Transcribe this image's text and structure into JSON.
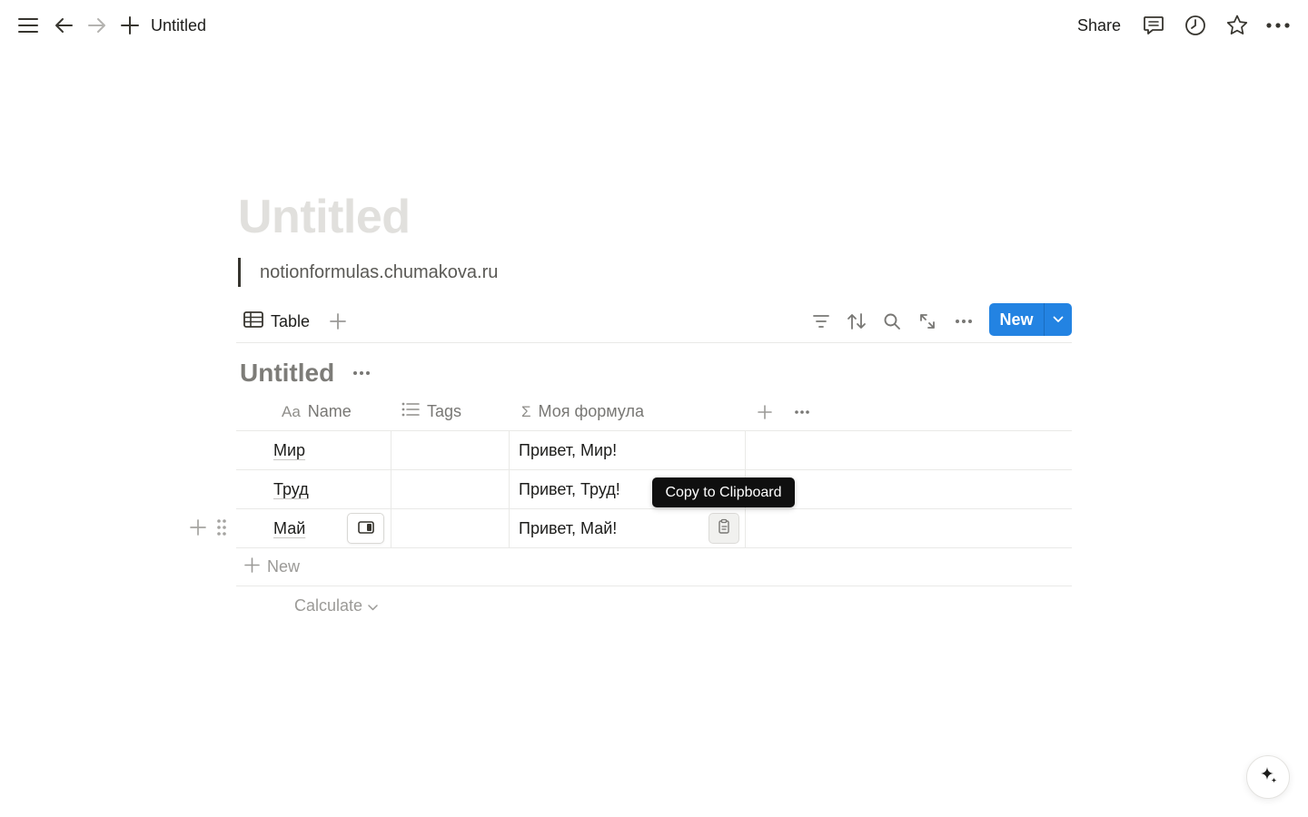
{
  "topbar": {
    "title": "Untitled",
    "share_label": "Share",
    "icons": [
      "menu-icon",
      "back-arrow-icon",
      "forward-arrow-icon",
      "plus-icon",
      "comment-icon",
      "clock-icon",
      "star-icon",
      "more-icon"
    ]
  },
  "page": {
    "title": "Untitled",
    "quote": "notionformulas.chumakova.ru"
  },
  "viewbar": {
    "tab_label": "Table",
    "new_label": "New",
    "accent_color": "#2383e2"
  },
  "database": {
    "title": "Untitled",
    "columns": [
      {
        "icon": "Aa",
        "label": "Name"
      },
      {
        "icon": "list-icon",
        "label": "Tags"
      },
      {
        "icon": "Σ",
        "label": "Моя формула"
      }
    ],
    "rows": [
      {
        "name": "Мир",
        "tags": "",
        "formula": "Привет, Мир!"
      },
      {
        "name": "Труд",
        "tags": "",
        "formula": "Привет, Труд!"
      },
      {
        "name": "Май",
        "tags": "",
        "formula": "Привет, Май!"
      }
    ],
    "new_row_label": "New",
    "calculate_label": "Calculate"
  },
  "tooltip": {
    "text": "Copy to Clipboard"
  }
}
